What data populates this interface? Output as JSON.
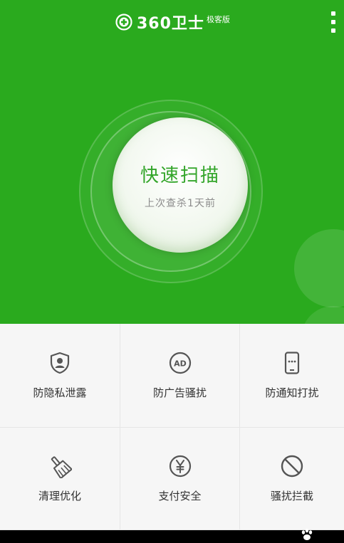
{
  "header": {
    "brand_name": "360卫士",
    "edition": "极客版",
    "logo_icon": "plus-circle-icon",
    "menu_icon": "more-vertical-icon"
  },
  "scan": {
    "title": "快速扫描",
    "subtitle": "上次查杀1天前"
  },
  "features": [
    {
      "label": "防隐私泄露",
      "icon": "shield-user-icon"
    },
    {
      "label": "防广告骚扰",
      "icon": "ad-block-icon"
    },
    {
      "label": "防通知打扰",
      "icon": "phone-notification-icon"
    },
    {
      "label": "清理优化",
      "icon": "broom-icon"
    },
    {
      "label": "支付安全",
      "icon": "yuan-icon"
    },
    {
      "label": "骚扰拦截",
      "icon": "block-icon"
    }
  ],
  "colors": {
    "primary_green": "#2aaa1e",
    "scan_text_green": "#33a52a",
    "icon_gray": "#555555"
  }
}
